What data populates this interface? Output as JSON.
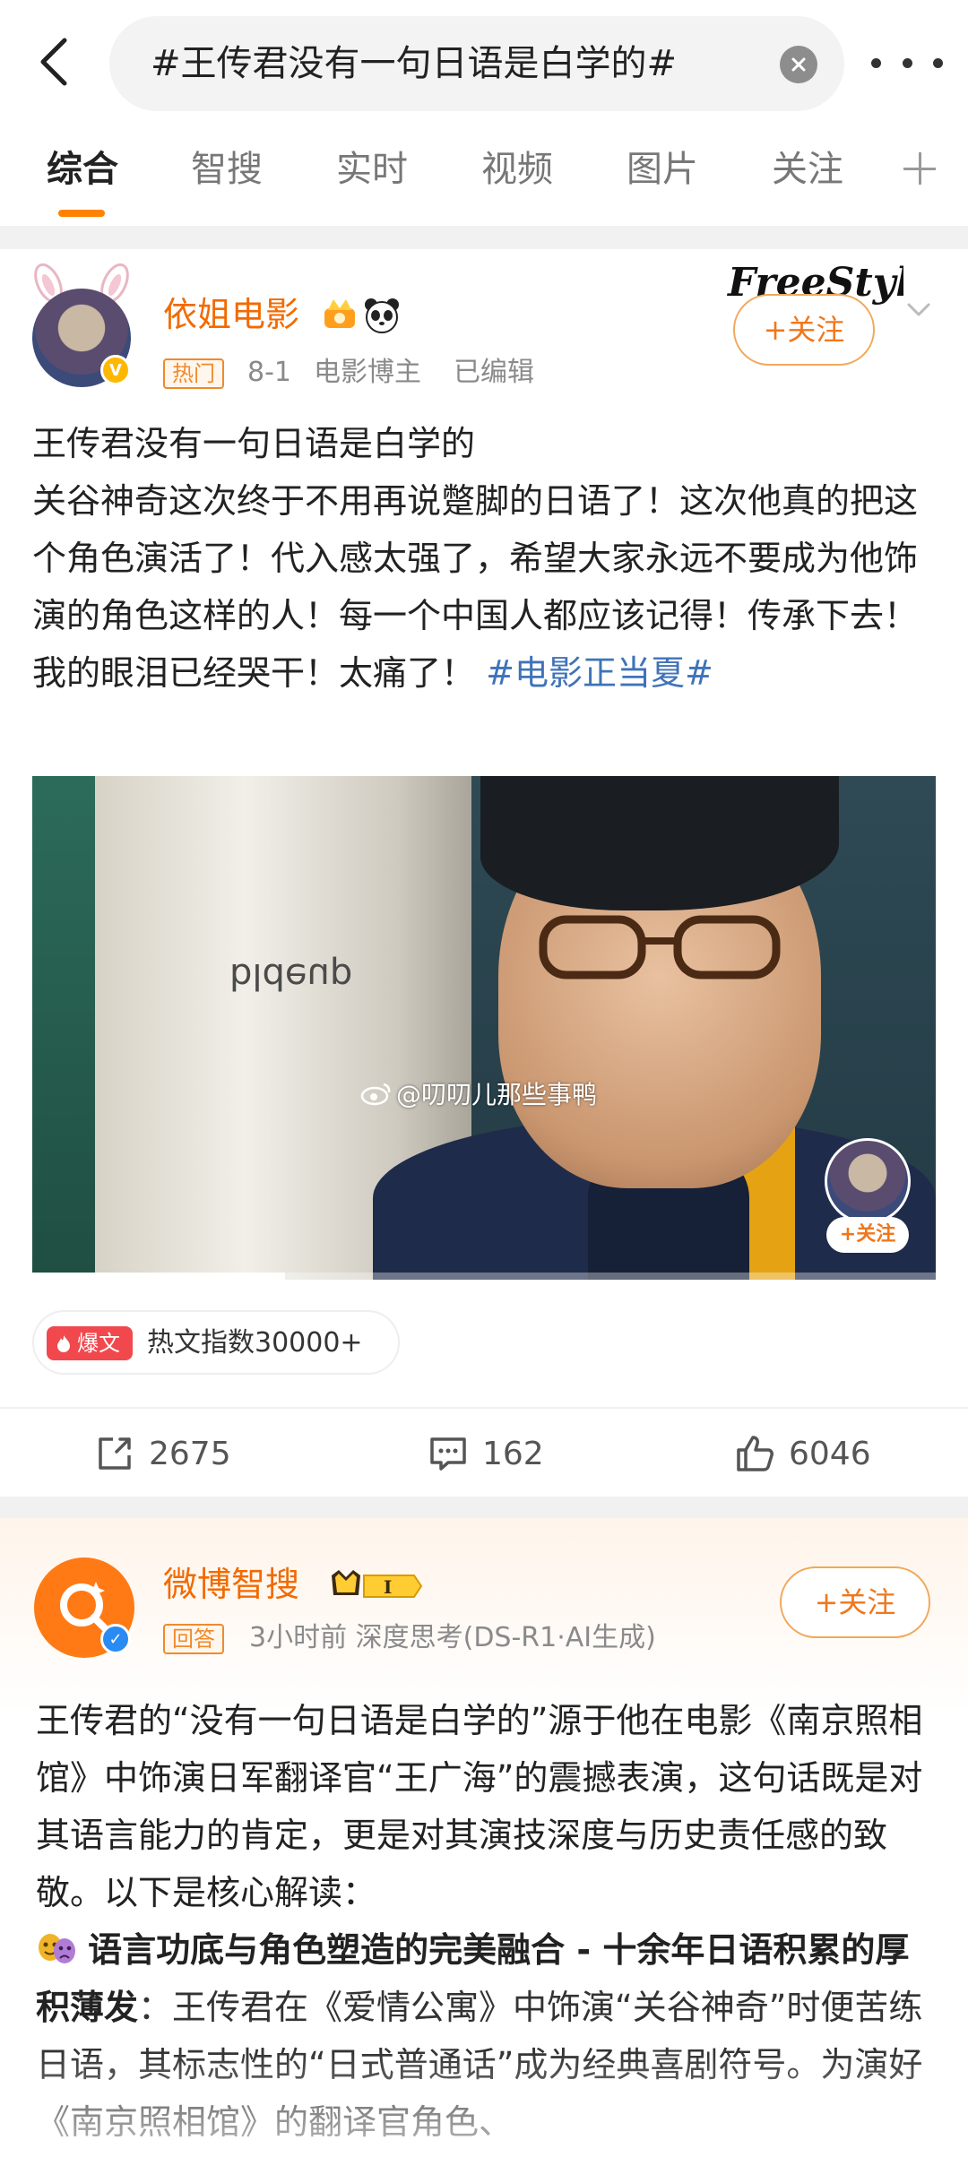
{
  "search": {
    "query": "#王传君没有一句日语是白学的#"
  },
  "tabs": [
    {
      "label": "综合",
      "active": true
    },
    {
      "label": "智搜"
    },
    {
      "label": "实时"
    },
    {
      "label": "视频"
    },
    {
      "label": "图片"
    },
    {
      "label": "关注"
    }
  ],
  "post1": {
    "author": "依姐电影",
    "hot_tag": "热门",
    "date": "8-1",
    "category": "电影博主",
    "edited": "已编辑",
    "follow_label": "关注",
    "text_line1": "王传君没有一句日语是白学的",
    "text_body": "关谷神奇这次终于不用再说蹩脚的日语了！这次他真的把这个角色演活了！代入感太强了，希望大家永远不要成为他饰演的角色这样的人！每一个中国人都应该记得！传承下去！我的眼泪已经哭干！太痛了！",
    "text_tag": "#电影正当夏#",
    "video": {
      "watermark": "@叨叨儿那些事鸭",
      "mini_follow": "+关注",
      "poster_text": "bldeup",
      "progress": 0.28
    },
    "hot_badge": "爆文",
    "hot_index": "热文指数30000+",
    "reposts": "2675",
    "comments": "162",
    "likes": "6046"
  },
  "post2": {
    "author": "微博智搜",
    "answer_tag": "回答",
    "meta": "3小时前 深度思考(DS-R1·AI生成)",
    "follow_label": "关注",
    "para1": "王传君的“没有一句日语是白学的”源于他在电影《南京照相馆》中饰演日军翻译官“王广海”的震撼表演，这句话既是对其语言能力的肯定，更是对其演技深度与历史责任感的致敬。以下是核心解读：",
    "section_title": "语言功底与角色塑造的完美融合 - 十余年日语积累的厚积薄发",
    "section_body": "：王传君在《爱情公寓》中饰演“关谷神奇”时便苦练日语，其标志性的“日式普通话”成为经典喜剧符号。为演好《南京照相馆》的翻译官角色、"
  },
  "colors": {
    "accent": "#ff8200",
    "author_name": "#f26a00",
    "link": "#3f73b8"
  }
}
